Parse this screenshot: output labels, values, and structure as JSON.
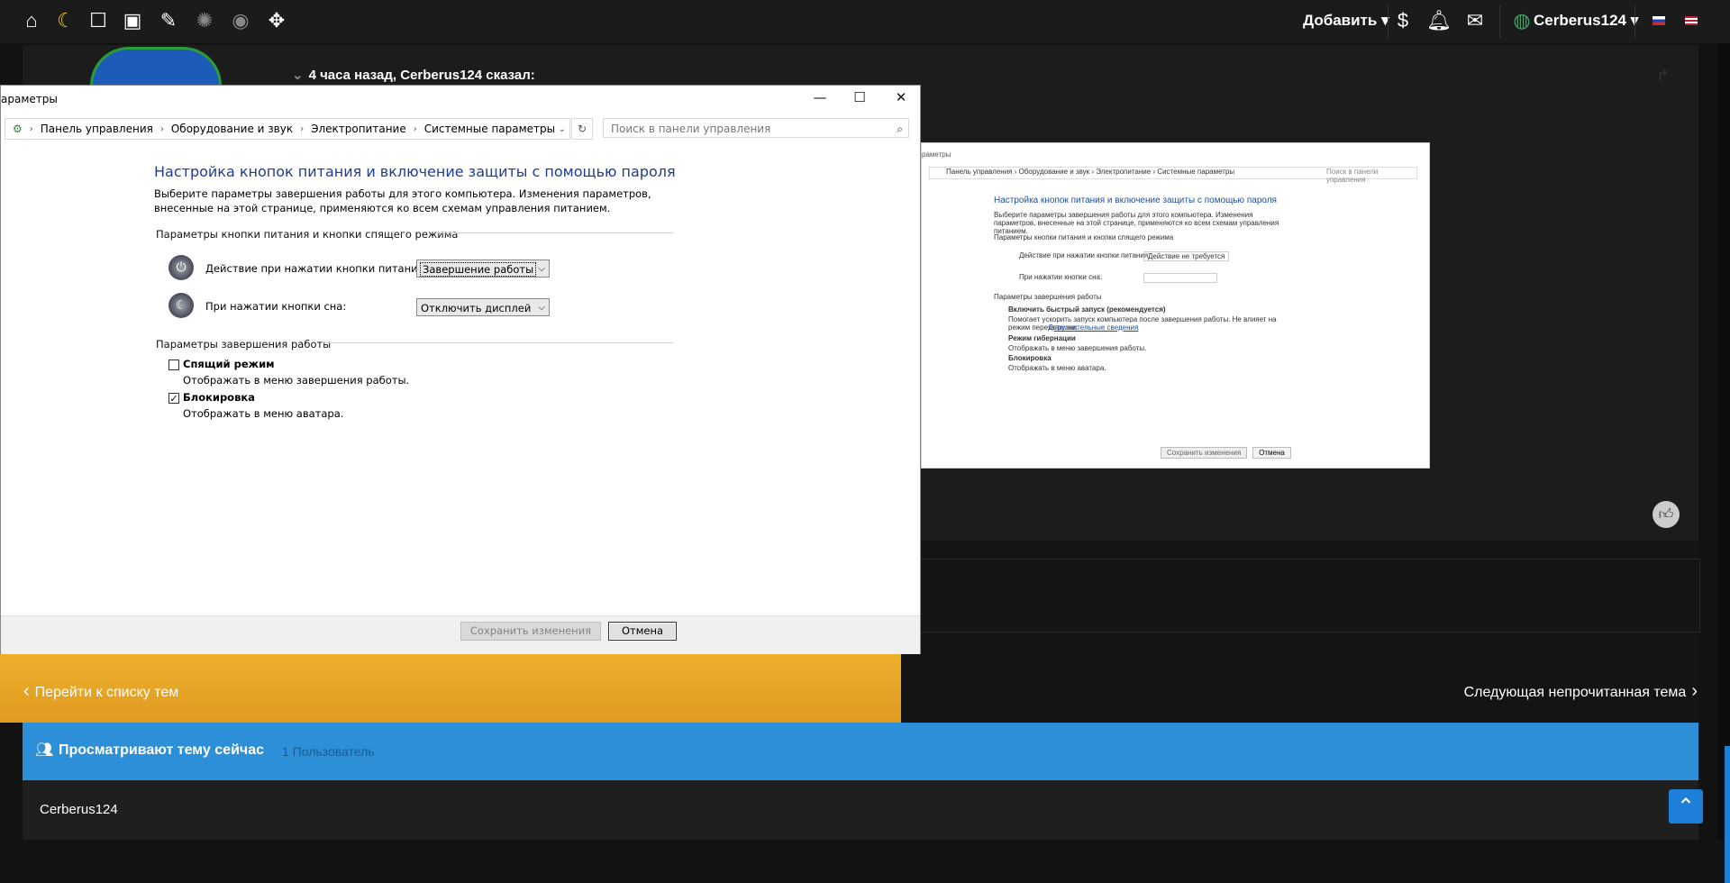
{
  "topbar": {
    "icons": [
      "home-icon",
      "moon-icon",
      "square-icon",
      "image-icon",
      "brush-icon",
      "spinner-icon",
      "eye-icon",
      "expand-icon"
    ],
    "add_label": "Добавить",
    "username": "Cerberus124",
    "flags": [
      "ru-flag-icon",
      "us-flag-icon"
    ]
  },
  "post": {
    "quote_header": "4 часа назад, Cerberus124 сказал:"
  },
  "navigation": {
    "prev": "Перейти к списку тем",
    "next": "Следующая непрочитанная тема"
  },
  "viewers": {
    "title": "Просматривают тему сейчас",
    "count": "1 Пользователь",
    "users": [
      "Cerberus124"
    ]
  },
  "dialog": {
    "title": "араметры",
    "breadcrumbs": [
      "Панель управления",
      "Оборудование и звук",
      "Электропитание",
      "Системные параметры"
    ],
    "search_placeholder": "Поиск в панели управления",
    "heading": "Настройка кнопок питания и включение защиты с помощью пароля",
    "description": "Выберите параметры завершения работы для этого компьютера. Изменения параметров, внесенные на этой странице, применяются ко всем схемам управления питанием.",
    "section1": "Параметры кнопки питания и кнопки спящего режима",
    "power_label": "Действие при нажатии кнопки питания:",
    "power_value": "Завершение работы",
    "sleep_label": "При нажатии кнопки сна:",
    "sleep_value": "Отключить дисплей",
    "section2": "Параметры завершения работы",
    "option1_label": "Спящий режим",
    "option1_desc": "Отображать в меню завершения работы.",
    "option1_checked": false,
    "option2_label": "Блокировка",
    "option2_desc": "Отображать в меню аватара.",
    "option2_checked": true,
    "save_button": "Сохранить изменения",
    "cancel_button": "Отмена"
  },
  "embedded": {
    "title": "раметры",
    "breadcrumbs": "Панель управления  ›  Оборудование и звук  ›  Электропитание  ›  Системные параметры",
    "search": "Поиск в панели управления",
    "heading": "Настройка кнопок питания и включение защиты с помощью пароля",
    "desc": "Выберите параметры завершения работы для этого компьютера. Изменения параметров, внесенные на этой странице, применяются ко всем схемам управления питанием.",
    "section1": "Параметры кнопки питания и кнопки спящего режима",
    "power_label": "Действие при нажатии кнопки питания:",
    "power_value": "Действие не требуется",
    "sleep_label": "При нажатии кнопки сна:",
    "section2": "Параметры завершения работы",
    "fast_label": "Включить быстрый запуск (рекомендуется)",
    "fast_desc": "Помогает ускорить запуск компьютера после завершения работы. Не влияет на режим перезагрузки.",
    "fast_link": "Дополнительные сведения",
    "hib_label": "Режим гибернации",
    "hib_desc": "Отображать в меню завершения работы.",
    "lock_label": "Блокировка",
    "lock_desc": "Отображать в меню аватара.",
    "save": "Сохранить изменения",
    "cancel": "Отмена"
  }
}
